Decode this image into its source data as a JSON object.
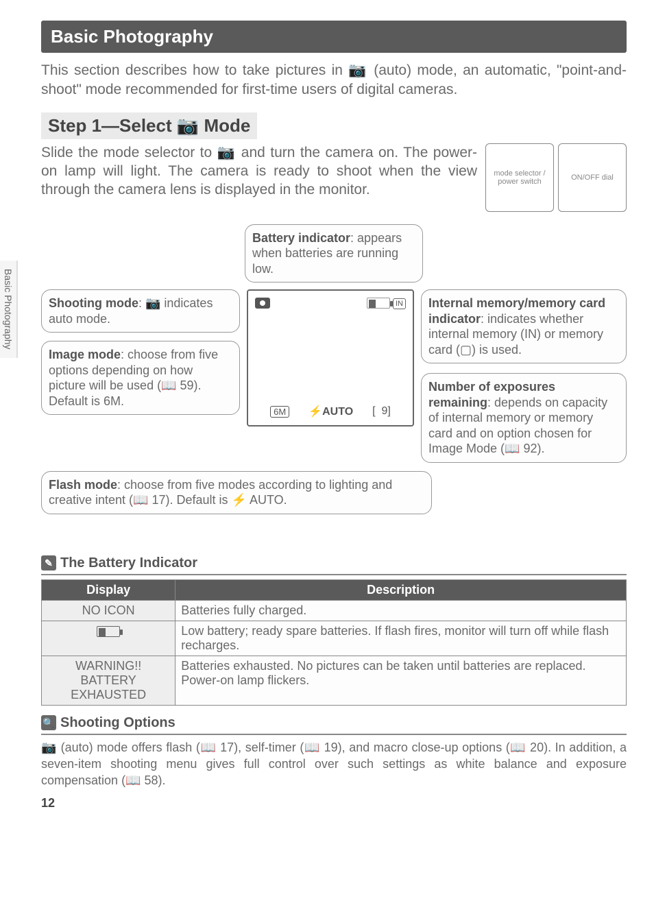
{
  "sideTab": "Basic Photography",
  "sectionHeader": "Basic Photography",
  "intro": "This section describes how to take pictures in 📷 (auto) mode, an automatic, \"point-and-shoot\" mode recommended for first-time users of digital cameras.",
  "step1": {
    "title": "Step 1—Select 📷 Mode",
    "desc": "Slide the mode selector to 📷 and turn the camera on. The power-on lamp will light. The camera is ready to shoot when the view through the camera lens is displayed in the monitor."
  },
  "callouts": {
    "battery": {
      "label": "Battery indicator",
      "text": ": appears when batteries are running low."
    },
    "shooting": {
      "label": "Shooting mode",
      "text": ": 📷 indicates auto mode."
    },
    "image": {
      "label": "Image mode",
      "text": ": choose from five options depending on how picture will be used (📖 59). Default is 6M."
    },
    "flash": {
      "label": "Flash mode",
      "text": ": choose from five modes according to lighting and creative intent (📖 17). Default is ⚡ AUTO."
    },
    "memory": {
      "label": "Internal memory/memory card indicator",
      "text": ": indicates whether internal memory (IN) or memory card (▢) is used."
    },
    "exposures": {
      "label": "Number of exposures remaining",
      "text": ": depends on capacity of internal memory or memory card and on option chosen for Image Mode (📖 92)."
    }
  },
  "screen": {
    "topLeftIcon": "camera",
    "topRightIcon": "IN",
    "bottomLeft": "6M",
    "bottomMid": "⚡AUTO",
    "bottomBracket": "[",
    "bottomRight": "9]"
  },
  "batterySection": {
    "title": "The Battery Indicator",
    "headers": {
      "display": "Display",
      "description": "Description"
    },
    "rows": [
      {
        "display": "NO ICON",
        "desc": "Batteries fully charged."
      },
      {
        "display": "batt-icon",
        "desc": "Low battery; ready spare batteries. If flash fires, monitor will turn off while flash recharges."
      },
      {
        "display": "WARNING!!\nBATTERY EXHAUSTED",
        "desc": "Batteries exhausted. No pictures can be taken until batteries are replaced. Power-on lamp flickers."
      }
    ]
  },
  "shootingOptions": {
    "title": "Shooting Options",
    "text": "📷 (auto) mode offers flash (📖 17), self-timer (📖 19), and macro close-up options (📖 20). In addition, a seven-item shooting menu gives full control over such settings as white balance and exposure compensation (📖 58)."
  },
  "pageNumber": "12"
}
